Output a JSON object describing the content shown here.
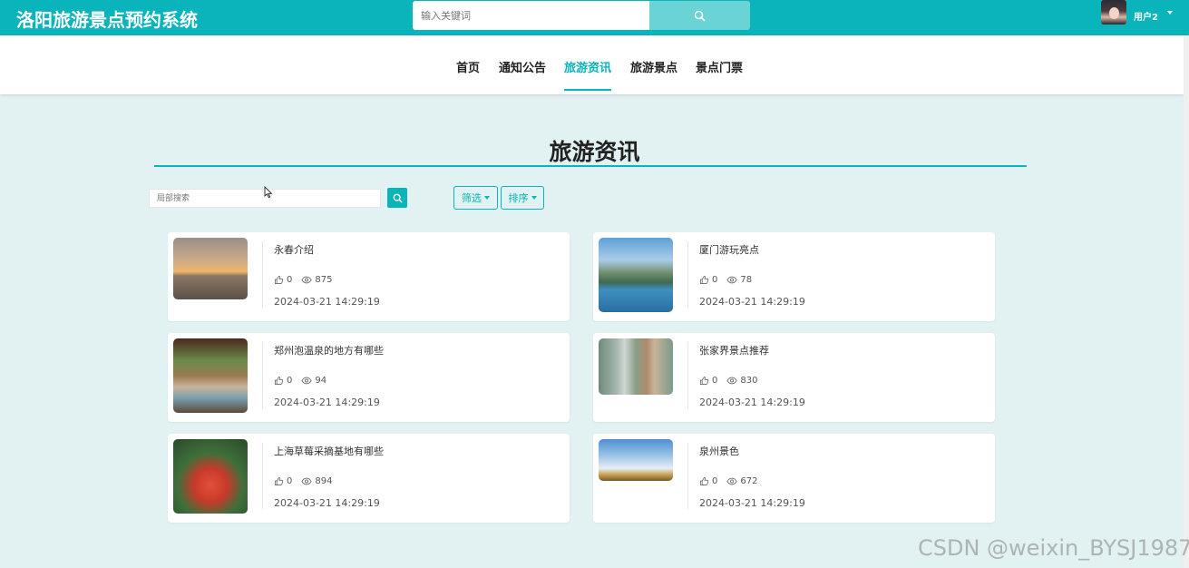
{
  "header": {
    "brand": "洛阳旅游景点预约系统",
    "search_placeholder": "输入关键词",
    "user_name": "用户2"
  },
  "nav": [
    {
      "label": "首页",
      "active": false
    },
    {
      "label": "通知公告",
      "active": false
    },
    {
      "label": "旅游资讯",
      "active": true
    },
    {
      "label": "旅游景点",
      "active": false
    },
    {
      "label": "景点门票",
      "active": false
    }
  ],
  "page": {
    "title": "旅游资讯",
    "search_placeholder": "局部搜索",
    "filter_label": "筛选",
    "sort_label": "排序"
  },
  "articles": [
    {
      "title": "永春介绍",
      "likes": "0",
      "views": "875",
      "time": "2024-03-21 14:29:19"
    },
    {
      "title": "厦门游玩亮点",
      "likes": "0",
      "views": "78",
      "time": "2024-03-21 14:29:19"
    },
    {
      "title": "郑州泡温泉的地方有哪些",
      "likes": "0",
      "views": "94",
      "time": "2024-03-21 14:29:19"
    },
    {
      "title": "张家界景点推荐",
      "likes": "0",
      "views": "830",
      "time": "2024-03-21 14:29:19"
    },
    {
      "title": "上海草莓采摘基地有哪些",
      "likes": "0",
      "views": "894",
      "time": "2024-03-21 14:29:19"
    },
    {
      "title": "泉州景色",
      "likes": "0",
      "views": "672",
      "time": "2024-03-21 14:29:19"
    }
  ],
  "watermark": "CSDN @weixin_BYSJ1987",
  "colors": {
    "accent": "#09b4bb",
    "background": "#e2f1f1",
    "search_button": "#6ad3d6"
  }
}
